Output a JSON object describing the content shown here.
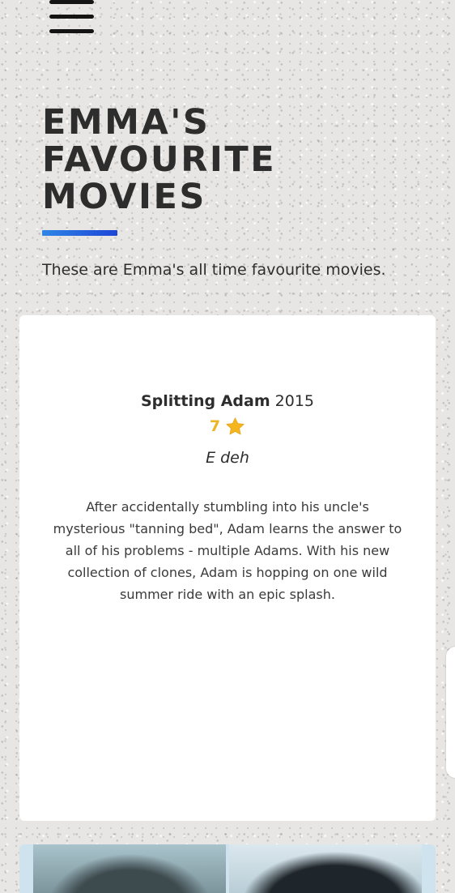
{
  "header": {
    "menu_icon": "hamburger-menu-icon",
    "title": "EMMA'S FAVOURITE MOVIES",
    "subtitle": "These are Emma's all time favourite movies.",
    "accent_colors": [
      "#2f86e6",
      "#1d45d6"
    ]
  },
  "movies": [
    {
      "title": "Splitting Adam",
      "year": "2015",
      "rating": "7",
      "rating_icon": "star-icon",
      "rating_color": "#ecb528",
      "tagline": "E deh",
      "description": "After accidentally stumbling into his uncle's mysterious \"tanning bed\", Adam learns the answer to all of his problems - multiple Adams. With his new collection of clones, Adam is hopping on one wild summer ride with an epic splash."
    }
  ]
}
